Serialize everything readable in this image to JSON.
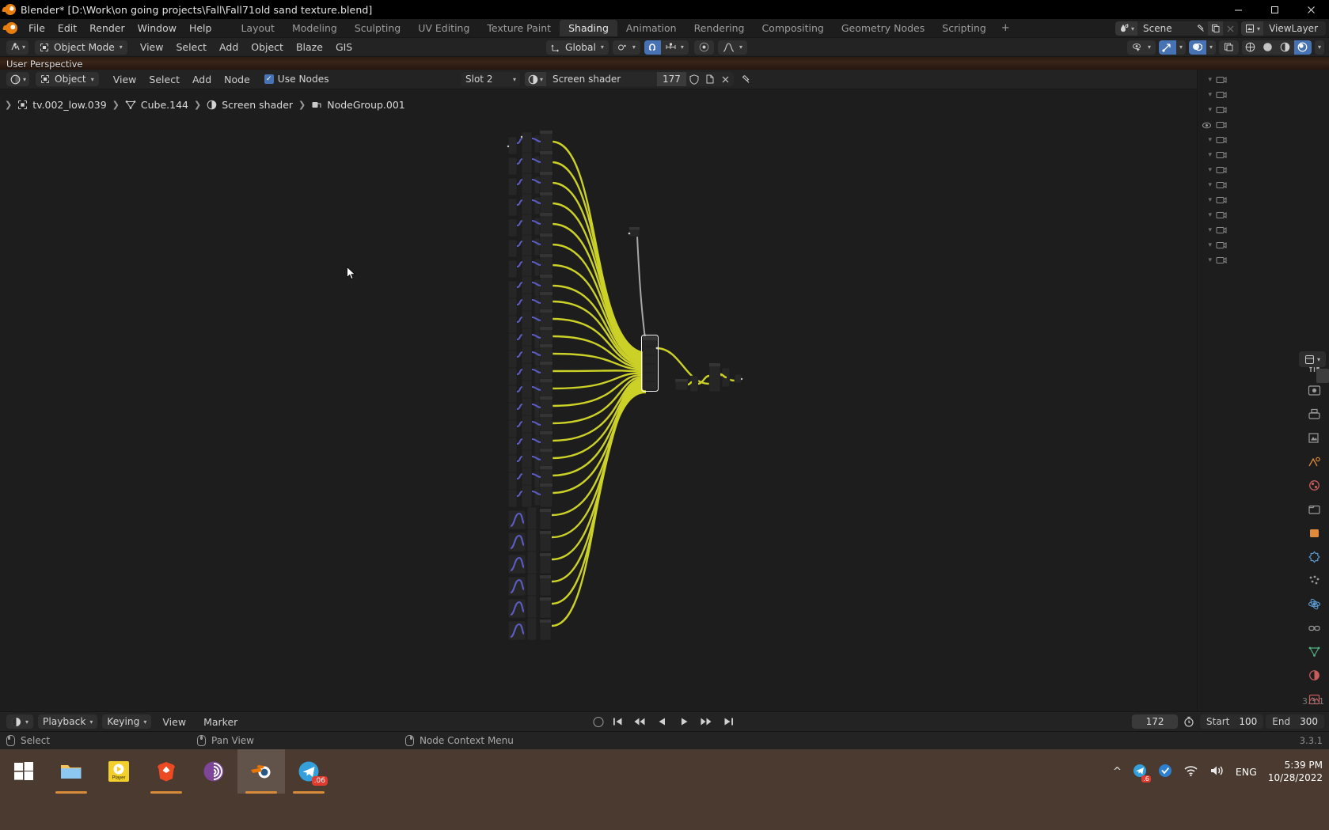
{
  "window": {
    "title": "Blender* [D:\\Work\\on going projects\\Fall\\Fall71old sand texture.blend]",
    "minimize": "─",
    "maximize": "☐",
    "close": "✕",
    "app_icon": "blender-logo-icon"
  },
  "topbar": {
    "menus": [
      "File",
      "Edit",
      "Render",
      "Window",
      "Help"
    ],
    "workspaces": [
      {
        "label": "Layout",
        "active": false
      },
      {
        "label": "Modeling",
        "active": false
      },
      {
        "label": "Sculpting",
        "active": false
      },
      {
        "label": "UV Editing",
        "active": false
      },
      {
        "label": "Texture Paint",
        "active": false
      },
      {
        "label": "Shading",
        "active": true
      },
      {
        "label": "Animation",
        "active": false
      },
      {
        "label": "Rendering",
        "active": false
      },
      {
        "label": "Compositing",
        "active": false
      },
      {
        "label": "Geometry Nodes",
        "active": false
      },
      {
        "label": "Scripting",
        "active": false
      }
    ],
    "add_workspace": "+",
    "scene_name": "Scene",
    "view_layer_name": "ViewLayer",
    "scene_pin_icon": "pin-icon",
    "scene_copy_icon": "duplicate-icon",
    "scene_delete_icon": "close-icon"
  },
  "viewport": {
    "overlay_text": "User Perspective",
    "editor_type_icon": "editor-type-icon",
    "mode": "Object Mode",
    "menus": [
      "View",
      "Select",
      "Add",
      "Object",
      "Blaze",
      "GIS"
    ],
    "transform_orientation": "Global",
    "pivot_icon": "pivot-point-icon",
    "snap_icon": "magnet-icon",
    "snap_target_icon": "snap-increment-icon",
    "proportional_icon": "proportional-edit-icon",
    "falloff_icon": "falloff-curve-icon",
    "visibility_icon": "show-hide-icon",
    "gizmo_icon": "gizmo-icon",
    "overlays_icon": "overlays-icon",
    "xray_icon": "xray-icon",
    "shading_wireframe_icon": "shading-wireframe-icon",
    "shading_solid_icon": "shading-solid-icon",
    "shading_material_icon": "shading-material-icon",
    "shading_rendered_icon": "shading-rendered-icon"
  },
  "shader_editor": {
    "editor_type_icon": "shader-editor-icon",
    "shader_type": "Object",
    "menus": [
      "View",
      "Select",
      "Add",
      "Node"
    ],
    "use_nodes_label": "Use Nodes",
    "use_nodes_checked": true,
    "slot": "Slot 2",
    "material_icon": "material-sphere-icon",
    "material_name": "Screen shader",
    "material_users": "177",
    "shield_icon": "fake-user-icon",
    "copy_icon": "new-material-icon",
    "unlink_icon": "unlink-icon",
    "pin_icon": "pin-icon",
    "snap_icon": "magnet-icon",
    "snap_grid_icon": "snap-grid-icon"
  },
  "breadcrumb": [
    {
      "label": "tv.002_low.039",
      "icon": "object-icon"
    },
    {
      "label": "Cube.144",
      "icon": "mesh-data-icon"
    },
    {
      "label": "Screen shader",
      "icon": "material-icon"
    },
    {
      "label": "NodeGroup.001",
      "icon": "node-group-icon"
    }
  ],
  "node_graph": {
    "wire_color": "#ccd128",
    "wire_color_shader": "#a0a0a0",
    "wire_color_vector": "#6363c7",
    "node_header_color": "#303030",
    "node_body_color": "#272727",
    "node_selected_outline": "#ffffff",
    "cluster_count": 24,
    "description": "Large fan of yellow noodles from 24 small node clusters converging into one tall selected mix node, then feeding a small node group at right"
  },
  "timeline": {
    "editor_icon": "timeline-editor-icon",
    "menus": [
      "Playback",
      "Keying",
      "View",
      "Marker"
    ],
    "record_icon": "auto-keying-icon",
    "jump_start_icon": "jump-to-start-icon",
    "prev_keyframe_icon": "prev-keyframe-icon",
    "play_reverse_icon": "play-reverse-icon",
    "play_icon": "play-icon",
    "next_keyframe_icon": "next-keyframe-icon",
    "jump_end_icon": "jump-to-end-icon",
    "current_frame": "172",
    "stopwatch_icon": "use-preview-range-icon",
    "start_label": "Start",
    "start_value": "100",
    "end_label": "End",
    "end_value": "300"
  },
  "statusbar": {
    "items": [
      {
        "icon": "mouse-left-icon",
        "label": "Select"
      },
      {
        "icon": "mouse-middle-icon",
        "label": "Pan View"
      },
      {
        "icon": "mouse-right-icon",
        "label": "Node Context Menu"
      }
    ],
    "version": "3.3.1"
  },
  "right_dock": {
    "version": "3.3.1",
    "tool_icon": "tool-icon",
    "render_icon": "render-properties-icon",
    "output_icon": "output-properties-icon",
    "viewlayer_icon": "view-layer-properties-icon",
    "scene_icon": "scene-properties-icon",
    "world_icon": "world-properties-icon",
    "collection_icon": "collection-properties-icon",
    "object_icon": "object-properties-icon",
    "modifier_icon": "modifier-properties-icon",
    "particles_icon": "particles-properties-icon",
    "physics_icon": "physics-properties-icon",
    "constraints_icon": "constraints-properties-icon",
    "data_icon": "object-data-properties-icon",
    "material_icon": "material-properties-icon",
    "texture_icon": "texture-properties-icon"
  },
  "taskbar": {
    "apps": [
      {
        "name": "start-button",
        "label": "",
        "active": false
      },
      {
        "name": "file-explorer",
        "label": "",
        "active": false
      },
      {
        "name": "media-player",
        "label": "Player",
        "active": false
      },
      {
        "name": "brave-browser",
        "label": "",
        "active": false
      },
      {
        "name": "tor-browser",
        "label": "",
        "active": false
      },
      {
        "name": "blender-app",
        "label": "",
        "active": true
      },
      {
        "name": "telegram",
        "label": ".06",
        "active": false
      }
    ],
    "tray": {
      "chevron_icon": "show-hidden-icons-icon",
      "badge": ".6",
      "network_icon": "wifi-icon",
      "volume_icon": "volume-icon",
      "language": "ENG",
      "time": "5:39 PM",
      "date": "10/28/2022"
    }
  }
}
